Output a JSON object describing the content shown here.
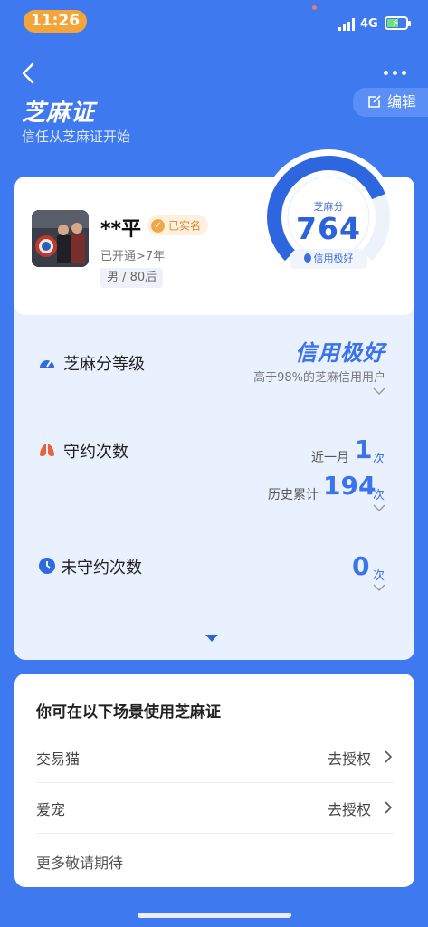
{
  "status_bar": {
    "time": "11:26",
    "network": "4G"
  },
  "header": {
    "title": "芝麻证",
    "subtitle": "信任从芝麻证开始",
    "edit_label": "编辑"
  },
  "profile": {
    "name": "**平",
    "verified_label": "已实名",
    "open_duration": "已开通>7年",
    "tag": "男 / 80后"
  },
  "score": {
    "label": "芝麻分",
    "value": "764",
    "level": "信用极好",
    "gauge_fraction": 0.75
  },
  "stats": {
    "grade": {
      "title": "芝麻分等级",
      "level": "信用极好",
      "desc": "高于98%的芝麻信用用户"
    },
    "kept": {
      "title": "守约次数",
      "recent_label": "近一月",
      "recent_value": "1",
      "history_label": "历史累计",
      "history_value": "194",
      "unit": "次"
    },
    "broken": {
      "title": "未守约次数",
      "value": "0",
      "unit": "次"
    }
  },
  "scenes": {
    "title": "你可在以下场景使用芝麻证",
    "items": [
      {
        "name": "交易猫",
        "action": "去授权"
      },
      {
        "name": "爱宠",
        "action": "去授权"
      }
    ],
    "more": "更多敬请期待"
  },
  "colors": {
    "background": "#3f79ef",
    "accent": "#3a73ea",
    "badge": "#f0a847",
    "time_pill": "#f3a53a"
  }
}
